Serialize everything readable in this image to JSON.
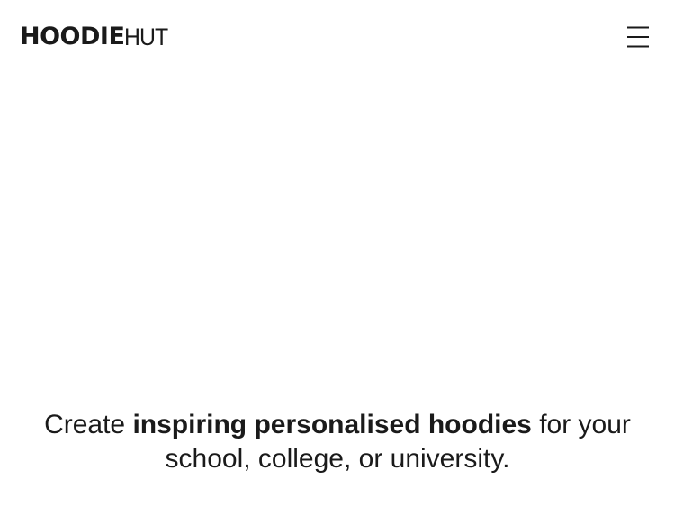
{
  "header": {
    "logo": {
      "part_bold": "HOODIE",
      "part_light": "HUT"
    },
    "menu_icon": "hamburger-menu-icon"
  },
  "hero": {
    "line_pre": "Create ",
    "line_bold": "inspiring personalised hoodies",
    "line_post": " for your school, college, or university."
  },
  "colors": {
    "text": "#1a1a1a",
    "background": "#ffffff"
  }
}
